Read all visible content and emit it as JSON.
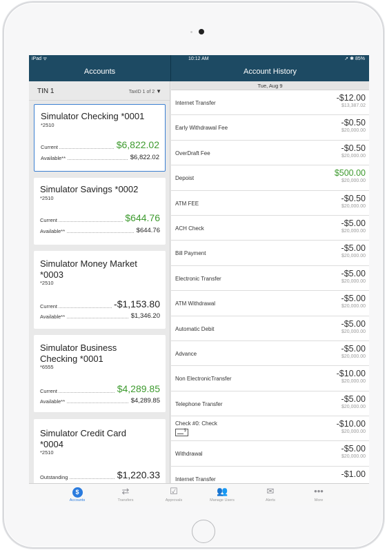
{
  "status": {
    "left": "iPad ᯤ",
    "time": "10:12 AM",
    "right": "➚ ✱ 85%"
  },
  "left_panel": {
    "title": "Accounts",
    "tin_label": "TIN 1",
    "taxid_label": "TaxID  1 of 2",
    "accounts": [
      {
        "name": "Simulator Checking *0001",
        "sub": "*2510",
        "row1_label": "Current",
        "row1_value": "$6,822.02",
        "row2_label": "Available**",
        "row2_value": "$6,822.02"
      },
      {
        "name": "Simulator Savings *0002",
        "sub": "*2510",
        "row1_label": "Current",
        "row1_value": "$644.76",
        "row2_label": "Available**",
        "row2_value": "$644.76"
      },
      {
        "name": "Simulator Money Market *0003",
        "sub": "*2510",
        "row1_label": "Current",
        "row1_value": "-$1,153.80",
        "row2_label": "Available**",
        "row2_value": "$1,346.20"
      },
      {
        "name": "Simulator Business Checking *0001",
        "sub": "*6555",
        "row1_label": "Current",
        "row1_value": "$4,289.85",
        "row2_label": "Available**",
        "row2_value": "$4,289.85"
      },
      {
        "name": "Simulator Credit Card *0004",
        "sub": "*2510",
        "row1_label": "Outstanding",
        "row1_value": "$1,220.33"
      }
    ]
  },
  "right_panel": {
    "title": "Account History",
    "date_header": "Tue, Aug 9",
    "transactions": [
      {
        "desc": "Internet Transfer",
        "amount": "-$12.00",
        "balance": "$13,387.02"
      },
      {
        "desc": "Early Withdrawal Fee",
        "amount": "-$0.50",
        "balance": "$20,000.00"
      },
      {
        "desc": "OverDraft Fee",
        "amount": "-$0.50",
        "balance": "$20,000.00"
      },
      {
        "desc": "Depoist",
        "amount": "$500.00",
        "balance": "$20,000.00"
      },
      {
        "desc": "ATM FEE",
        "amount": "-$0.50",
        "balance": "$20,000.00"
      },
      {
        "desc": "ACH Check",
        "amount": "-$5.00",
        "balance": "$20,000.00"
      },
      {
        "desc": "Bill Payment",
        "amount": "-$5.00",
        "balance": "$20,000.00"
      },
      {
        "desc": "Electronic Transfer",
        "amount": "-$5.00",
        "balance": "$20,000.00"
      },
      {
        "desc": "ATM Withdrawal",
        "amount": "-$5.00",
        "balance": "$20,000.00"
      },
      {
        "desc": "Automatic Debit",
        "amount": "-$5.00",
        "balance": "$20,000.00"
      },
      {
        "desc": "Advance",
        "amount": "-$5.00",
        "balance": "$20,000.00"
      },
      {
        "desc": "Non ElectronicTransfer",
        "amount": "-$10.00",
        "balance": "$20,000.00"
      },
      {
        "desc": "Telephone Transfer",
        "amount": "-$5.00",
        "balance": "$20,000.00"
      },
      {
        "desc": "Check #0: Check",
        "amount": "-$10.00",
        "balance": "$20,000.00"
      },
      {
        "desc": "Withdrawal",
        "amount": "-$5.00",
        "balance": "$20,000.00"
      },
      {
        "desc": "Internet Transfer",
        "amount": "-$1.00",
        "balance": ""
      }
    ]
  },
  "tabbar": {
    "tabs": [
      {
        "label": "Accounts",
        "icon": "dollar-icon"
      },
      {
        "label": "Transfers",
        "icon": "transfer-arrows-icon"
      },
      {
        "label": "Approvals",
        "icon": "checkbox-icon"
      },
      {
        "label": "Manage Users",
        "icon": "users-icon"
      },
      {
        "label": "Alerts",
        "icon": "envelope-icon"
      },
      {
        "label": "More",
        "icon": "ellipsis-icon"
      }
    ]
  },
  "colors": {
    "nav_bg": "#1d4a63",
    "positive": "#3d9a2e",
    "selected_border": "#3b7fd1",
    "tab_active": "#2a7bde"
  }
}
